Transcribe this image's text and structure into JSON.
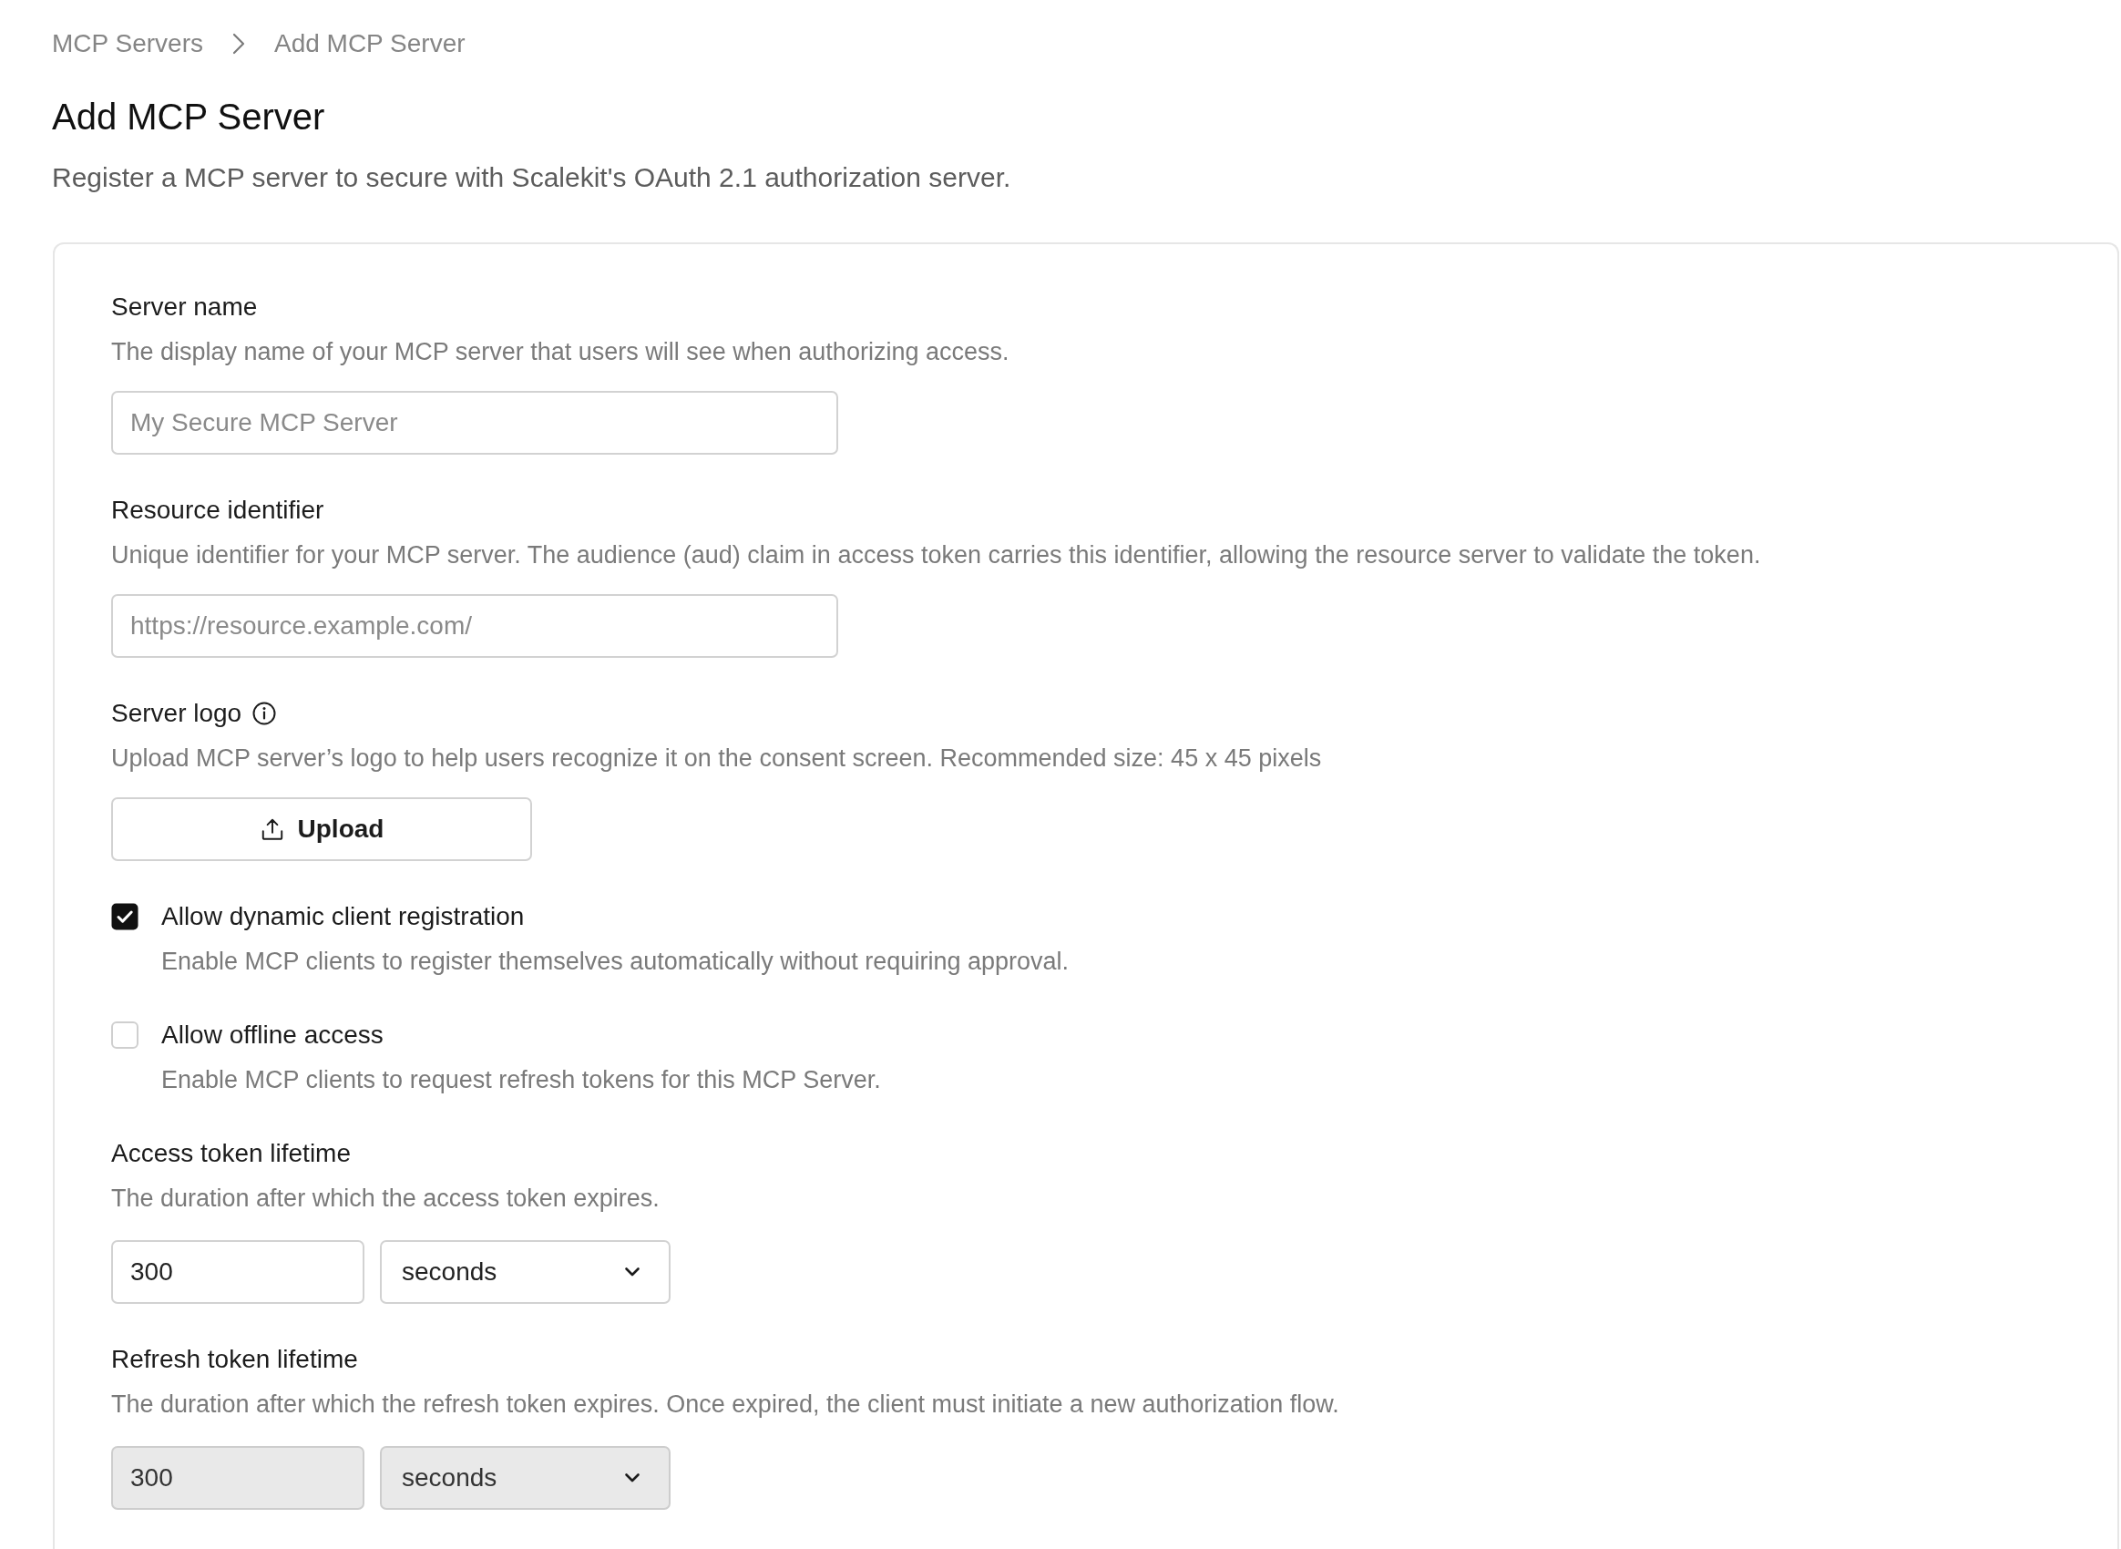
{
  "breadcrumb": [
    {
      "label": "MCP Servers"
    },
    {
      "label": "Add MCP Server"
    }
  ],
  "page": {
    "title": "Add MCP Server",
    "subtitle": "Register a MCP server to secure with Scalekit's OAuth 2.1 authorization server."
  },
  "form": {
    "fields": [
      {
        "kind": "text",
        "label": "Server name",
        "description": "The display name of your MCP server that users will see when authorizing access.",
        "placeholder": "My Secure MCP Server"
      },
      {
        "kind": "text",
        "label": "Resource identifier",
        "description": "Unique identifier for your MCP server. The audience (aud) claim in access token carries this identifier, allowing the resource server to validate the token.",
        "placeholder": "https://resource.example.com/"
      },
      {
        "kind": "upload",
        "label": "Server logo",
        "info": true,
        "description": "Upload MCP server’s logo to help users recognize it on the consent screen. Recommended size: 45 x 45 pixels",
        "button": "Upload"
      },
      {
        "kind": "checkbox",
        "label": "Allow dynamic client registration",
        "description": "Enable MCP clients to register themselves automatically without requiring approval.",
        "checked": true
      },
      {
        "kind": "checkbox",
        "label": "Allow offline access",
        "description": "Enable MCP clients to request refresh tokens for this MCP Server.",
        "checked": false
      },
      {
        "kind": "duration",
        "label": "Access token lifetime",
        "description": "The duration after which the access token expires.",
        "value": "300",
        "unit": "seconds",
        "disabled": false
      },
      {
        "kind": "duration",
        "label": "Refresh token lifetime",
        "description": "The duration after which the refresh token expires. Once expired, the client must initiate a new authorization flow.",
        "value": "300",
        "unit": "seconds",
        "disabled": true
      }
    ]
  }
}
